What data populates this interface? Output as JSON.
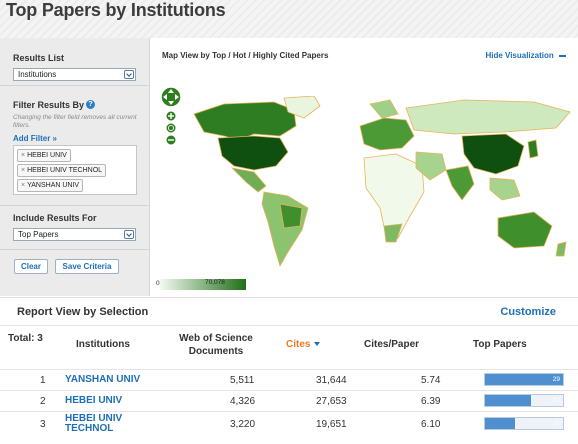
{
  "page_title": "Top Papers by Institutions",
  "left_panel": {
    "results_list_label": "Results List",
    "results_list_value": "Institutions",
    "filter_label": "Filter Results By",
    "help_icon": "?",
    "filter_hint": "Changing the filter field removes all current filters.",
    "add_filter": "Add Filter »",
    "filters": [
      "HEBEI UNIV",
      "HEBEI UNIV TECHNOL",
      "YANSHAN UNIV"
    ],
    "include_label": "Include Results For",
    "include_value": "Top Papers",
    "clear_button": "Clear",
    "save_button": "Save Criteria"
  },
  "map": {
    "title": "Map View by Top / Hot / Highly Cited Papers",
    "hide_link": "Hide Visualization",
    "legend_min": "0",
    "legend_max": "70,078"
  },
  "report": {
    "title": "Report View by Selection",
    "customize": "Customize",
    "headers": {
      "total": "Total: 3",
      "institutions": "Institutions",
      "wos_line1": "Web of Science",
      "wos_line2": "Documents",
      "cites": "Cites",
      "cites_per_paper": "Cites/Paper",
      "top_papers": "Top Papers"
    },
    "rows": [
      {
        "rank": "1",
        "name_line1": "YANSHAN UNIV",
        "name_line2": "",
        "docs": "5,511",
        "cites": "31,644",
        "cpp": "5.74",
        "top_papers": "29",
        "top_papers_value": 29
      },
      {
        "rank": "2",
        "name_line1": "HEBEI UNIV",
        "name_line2": "",
        "docs": "4,326",
        "cites": "27,653",
        "cpp": "6.39",
        "top_papers": "17",
        "top_papers_value": 17
      },
      {
        "rank": "3",
        "name_line1": "HEBEI UNIV",
        "name_line2": "TECHNOL",
        "docs": "3,220",
        "cites": "19,651",
        "cpp": "6.10",
        "top_papers": "11",
        "top_papers_value": 11
      }
    ],
    "top_papers_max": 29
  },
  "colors": {
    "accent_blue": "#1d6fb8",
    "sort_orange": "#ef7a22",
    "bar_blue": "#4f8fd0",
    "map_dark_green": "#1f6f18"
  }
}
